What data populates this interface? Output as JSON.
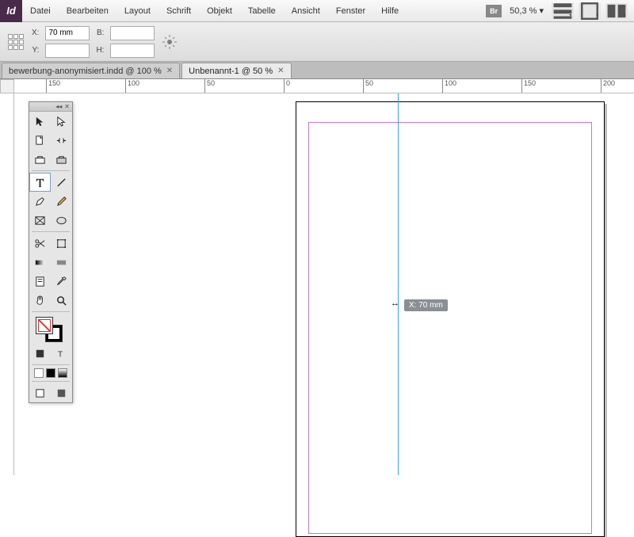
{
  "app": {
    "icon_text": "Id"
  },
  "menu": [
    "Datei",
    "Bearbeiten",
    "Layout",
    "Schrift",
    "Objekt",
    "Tabelle",
    "Ansicht",
    "Fenster",
    "Hilfe"
  ],
  "menubar_right": {
    "bridge_badge": "Br",
    "zoom": "50,3 %"
  },
  "controlbar": {
    "x_label": "X:",
    "y_label": "Y:",
    "w_label": "B:",
    "h_label": "H:",
    "x_value": "70 mm",
    "y_value": "",
    "w_value": "",
    "h_value": ""
  },
  "tabs": [
    {
      "label": "bewerbung-anonymisiert.indd @ 100 %",
      "active": false
    },
    {
      "label": "Unbenannt-1 @ 50 %",
      "active": true
    }
  ],
  "ruler": {
    "marks": [
      "150",
      "100",
      "50",
      "0",
      "50",
      "100",
      "150",
      "200"
    ]
  },
  "guide": {
    "tooltip": "X: 70 mm",
    "cursor": "↔"
  },
  "tools": {
    "collapse": "◂◂",
    "close": "✕"
  }
}
